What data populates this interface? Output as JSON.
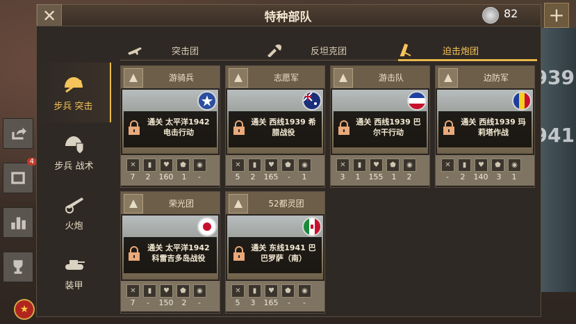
{
  "header": {
    "title": "特种部队",
    "medals": "82"
  },
  "background": {
    "badge_count": "4",
    "years": [
      "1939",
      "941"
    ]
  },
  "tabs": [
    {
      "label": "突击团",
      "icon": "rifle-icon"
    },
    {
      "label": "反坦克团",
      "icon": "rocket-launcher-icon"
    },
    {
      "label": "迫击炮团",
      "icon": "mortar-icon",
      "active": true
    }
  ],
  "sidebar": [
    {
      "label": "步兵 突击",
      "icon": "helmet-assault-icon",
      "active": true
    },
    {
      "label": "步兵 战术",
      "icon": "helmet-shield-icon"
    },
    {
      "label": "火炮",
      "icon": "artillery-icon"
    },
    {
      "label": "装甲",
      "icon": "tank-icon"
    }
  ],
  "cards": [
    {
      "name": "游骑兵",
      "flag": "usa",
      "unlock": "通关 太平洋1942 电击行动",
      "stats": [
        "7",
        "2",
        "160",
        "1",
        "-"
      ]
    },
    {
      "name": "志愿军",
      "flag": "australia",
      "unlock": "通关 西线1939 希腊战役",
      "stats": [
        "5",
        "2",
        "165",
        "-",
        "1"
      ]
    },
    {
      "name": "游击队",
      "flag": "yugoslavia",
      "unlock": "通关 西线1939 巴尔干行动",
      "stats": [
        "3",
        "1",
        "155",
        "1",
        "2"
      ]
    },
    {
      "name": "边防军",
      "flag": "romania",
      "unlock": "通关 西线1939 玛莉塔作战",
      "stats": [
        "-",
        "2",
        "140",
        "3",
        "1"
      ]
    },
    {
      "name": "荣光团",
      "flag": "japan",
      "unlock": "通关 太平洋1942 科雷吉多岛战役",
      "stats": [
        "7",
        "-",
        "150",
        "2",
        "-"
      ]
    },
    {
      "name": "52都灵团",
      "flag": "italy",
      "unlock": "通关 东线1941 巴巴罗萨（南）",
      "stats": [
        "5",
        "3",
        "165",
        "-",
        "-"
      ]
    }
  ],
  "colors": {
    "accent": "#e9b84a",
    "panel": "#2f2925",
    "card_header": "#6d5e4a"
  }
}
